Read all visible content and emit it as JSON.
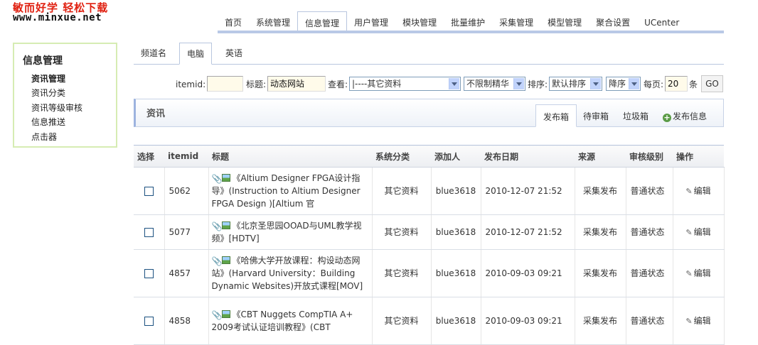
{
  "logo": {
    "slogan": "敏而好学  轻松下载",
    "url": "www.minxue.net"
  },
  "topnav": [
    "首页",
    "系统管理",
    "信息管理",
    "用户管理",
    "模块管理",
    "批量维护",
    "采集管理",
    "模型管理",
    "聚合设置",
    "UCenter"
  ],
  "sidebar": {
    "title": "信息管理",
    "items": [
      "资讯管理",
      "资讯分类",
      "资讯等级审核",
      "信息推送",
      "点击器"
    ]
  },
  "channel_tabs": [
    "频道名",
    "电脑",
    "英语"
  ],
  "filter": {
    "itemid_label": "itemid:",
    "itemid_value": "",
    "title_label": "标题:",
    "title_value": "动态网站",
    "view_label": "查看:",
    "view_value": "|----其它资料",
    "essence_value": "不限制精华",
    "sort_label": "排序:",
    "sort_value": "默认排序",
    "order_value": "降序",
    "per_page_label": "每页:",
    "per_page_value": "20",
    "per_page_unit": "条",
    "go_label": "GO"
  },
  "section": {
    "title": "资讯",
    "tabs": [
      "发布箱",
      "待审箱",
      "垃圾箱",
      "发布信息"
    ]
  },
  "table": {
    "headers": [
      "选择",
      "itemid",
      "标题",
      "系统分类",
      "添加人",
      "发布日期",
      "来源",
      "审核级别",
      "操作"
    ],
    "rows": [
      {
        "itemid": "5062",
        "title": "《Altium Designer FPGA设计指导》(Instruction to Altium Designer FPGA Design )[Altium 官",
        "category": "其它资料",
        "author": "blue3618",
        "date": "2010-12-07 21:52",
        "source": "采集发布",
        "level": "普通状态",
        "action": "编辑"
      },
      {
        "itemid": "5077",
        "title": "《北京圣思园OOAD与UML教学视频》[HDTV]",
        "category": "其它资料",
        "author": "blue3618",
        "date": "2010-12-07 21:52",
        "source": "采集发布",
        "level": "普通状态",
        "action": "编辑"
      },
      {
        "itemid": "4857",
        "title": "《哈佛大学开放课程：构设动态网站》(Harvard University：Building Dynamic Websites)开放式课程[MOV]",
        "category": "其它资料",
        "author": "blue3618",
        "date": "2010-09-03 09:21",
        "source": "采集发布",
        "level": "普通状态",
        "action": "编辑"
      },
      {
        "itemid": "4858",
        "title": "《CBT Nuggets CompTIA A+ 2009考试认证培训教程》(CBT",
        "category": "其它资料",
        "author": "blue3618",
        "date": "2010-09-03 09:21",
        "source": "采集发布",
        "level": "普通状态",
        "action": "编辑"
      }
    ]
  }
}
